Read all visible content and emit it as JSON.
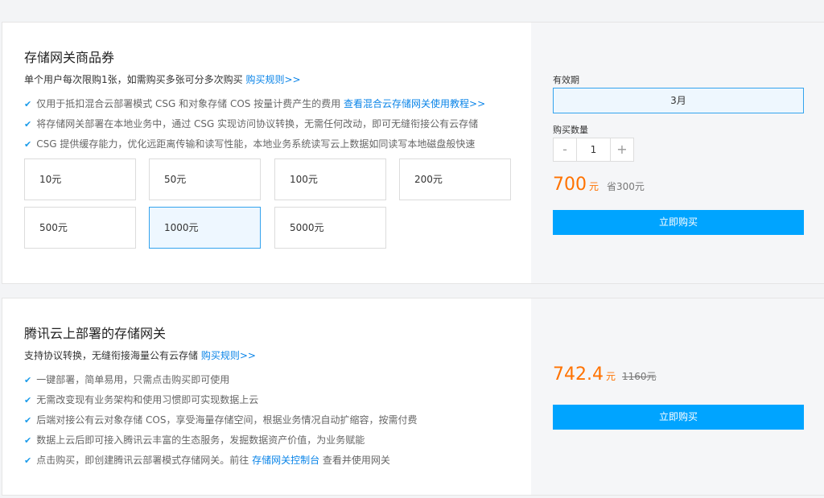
{
  "product1": {
    "title": "存储网关商品券",
    "desc": "单个用户每次限购1张，如需购买多张可分多次购买",
    "desc_link": "购买规则>>",
    "features": [
      {
        "text": "仅用于抵扣混合云部署模式 CSG 和对象存储 COS 按量计费产生的费用",
        "link": "查看混合云存储网关使用教程>>"
      },
      {
        "text": "将存储网关部署在本地业务中，通过 CSG 实现访问协议转换，无需任何改动，即可无缝衔接公有云存储",
        "link": ""
      },
      {
        "text": "CSG 提供缓存能力，优化远距离传输和读写性能，本地业务系统读写云上数据如同读写本地磁盘般快速",
        "link": ""
      }
    ],
    "options": [
      "10元",
      "50元",
      "100元",
      "200元",
      "500元",
      "1000元",
      "5000元"
    ],
    "selected_option": "1000元",
    "validity_label": "有效期",
    "validity_value": "3月",
    "quantity_label": "购买数量",
    "quantity_minus": "-",
    "quantity_value": "1",
    "quantity_plus": "+",
    "price": "700",
    "price_unit": "元",
    "save_text": "省300元",
    "buy_label": "立即购买"
  },
  "product2": {
    "title": "腾讯云上部署的存储网关",
    "desc": "支持协议转换，无缝衔接海量公有云存储",
    "desc_link": "购买规则>>",
    "features": [
      {
        "text": "一键部署，简单易用，只需点击购买即可使用",
        "link": "",
        "after": ""
      },
      {
        "text": "无需改变现有业务架构和使用习惯即可实现数据上云",
        "link": "",
        "after": ""
      },
      {
        "text": "后端对接公有云对象存储 COS，享受海量存储空间，根据业务情况自动扩缩容，按需付费",
        "link": "",
        "after": ""
      },
      {
        "text": "数据上云后即可接入腾讯云丰富的生态服务，发掘数据资产价值，为业务赋能",
        "link": "",
        "after": ""
      },
      {
        "text": "点击购买，即创建腾讯云部署模式存储网关。前往",
        "link": "存储网关控制台",
        "after": "查看并使用网关"
      }
    ],
    "price": "742.4",
    "price_unit": "元",
    "original_price": "1160元",
    "buy_label": "立即购买"
  },
  "colors": {
    "accent": "#00a4ff",
    "price": "#ff7200",
    "link": "#0a84e8"
  }
}
